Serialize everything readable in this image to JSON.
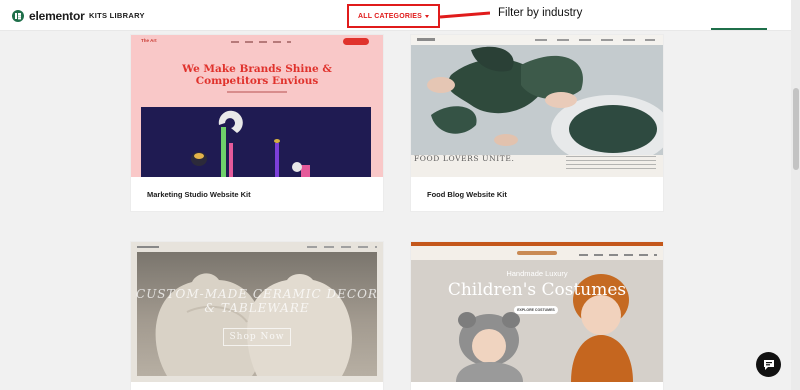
{
  "header": {
    "brand_name": "elementor",
    "kits_label": "KITS LIBRARY",
    "category_label": "ALL CATEGORIES",
    "annotation": "Filter by industry"
  },
  "colors": {
    "brand_green": "#1f6f4a",
    "highlight_red": "#e01b1b",
    "page_bg": "#f1f1f1"
  },
  "cards": [
    {
      "title": "Marketing Studio Website Kit",
      "preview": {
        "logo": "The Art",
        "headline": "We Make Brands Shine & Competitors Envious"
      }
    },
    {
      "title": "Food Blog Website Kit",
      "preview": {
        "caption": "FOOD LOVERS UNITE."
      }
    },
    {
      "title": "",
      "preview": {
        "headline": "Custom-Made Ceramic Decor & Tableware",
        "button": "Shop Now"
      }
    },
    {
      "title": "",
      "preview": {
        "small": "Handmade Luxury",
        "headline": "Children's Costumes",
        "button": "EXPLORE COSTUMES"
      }
    }
  ],
  "icons": {
    "brand_logo": "elementor-logo",
    "caret": "caret-down-icon",
    "chat": "chat-bubble-icon"
  }
}
